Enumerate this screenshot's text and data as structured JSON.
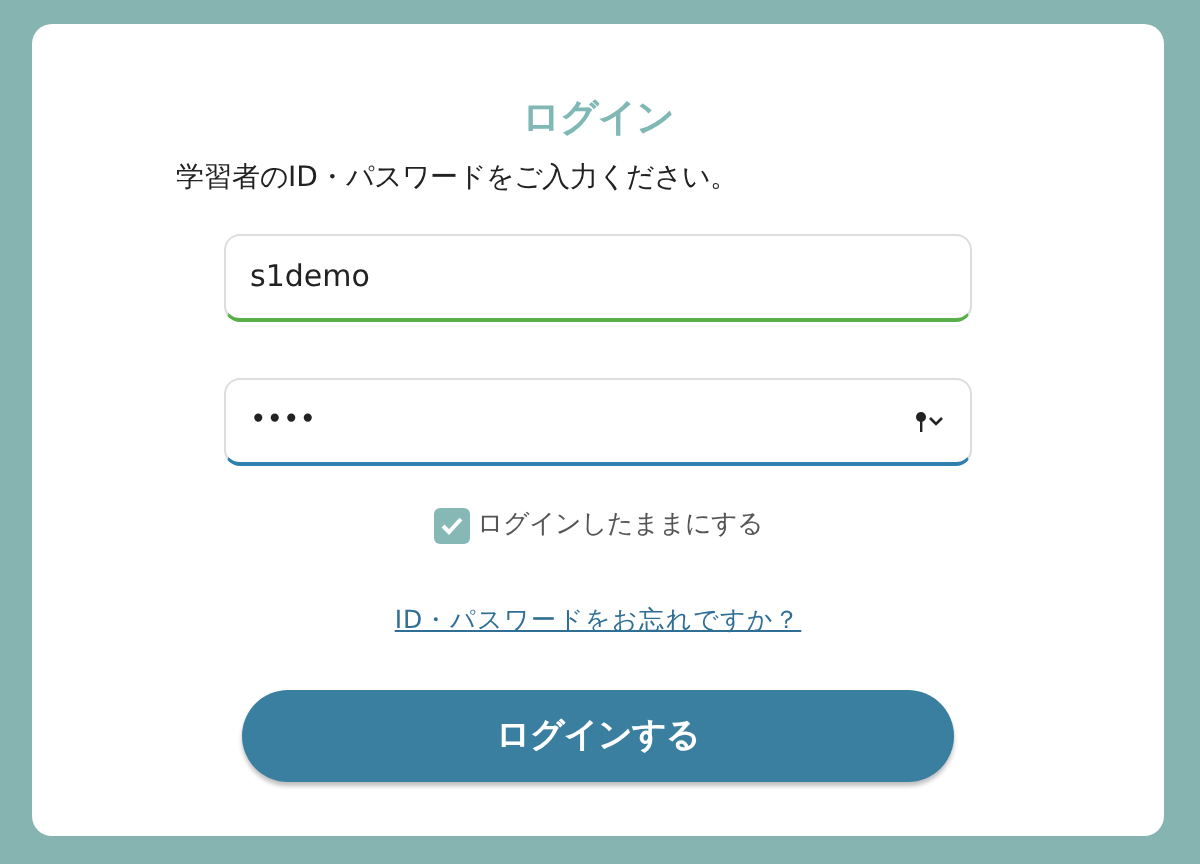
{
  "title": "ログイン",
  "instruction": "学習者のID・パスワードをご入力ください。",
  "id_field": {
    "value": "s1demo"
  },
  "password_field": {
    "value": "••••"
  },
  "remember": {
    "label": "ログインしたままにする",
    "checked": true
  },
  "forgot_link": "ID・パスワードをお忘れですか？",
  "submit_button": "ログインする"
}
